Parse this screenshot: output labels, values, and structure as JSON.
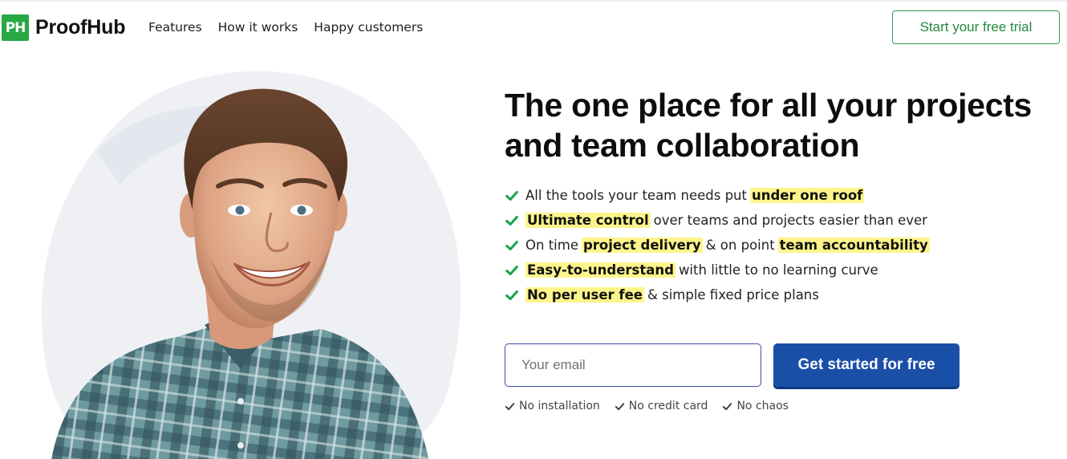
{
  "brand": {
    "badge": "PH",
    "name": "ProofHub",
    "accent": "#27a844"
  },
  "nav": {
    "items": [
      "Features",
      "How it works",
      "Happy customers"
    ]
  },
  "header": {
    "trial_label": "Start your free trial"
  },
  "hero": {
    "headline": "The one place for all your projects and team collaboration",
    "features": [
      {
        "a": "All the tools your team needs put ",
        "b": "under one roof",
        "c": ""
      },
      {
        "a": "",
        "b": "Ultimate control",
        "c": " over teams and projects easier than ever"
      },
      {
        "a": "On time ",
        "b": "project delivery",
        "c": " & on point ",
        "d": "team accountability"
      },
      {
        "a": "",
        "b": "Easy-to-understand",
        "c": " with little to no learning curve"
      },
      {
        "a": "",
        "b": "No per user fee",
        "c": " & simple fixed price plans"
      }
    ],
    "check_icon": "green-check-icon"
  },
  "signup": {
    "email_placeholder": "Your email",
    "email_value": "",
    "cta_label": "Get started for free",
    "cta_color": "#1a4fa7",
    "perks": [
      "No installation",
      "No credit card",
      "No chaos"
    ]
  }
}
